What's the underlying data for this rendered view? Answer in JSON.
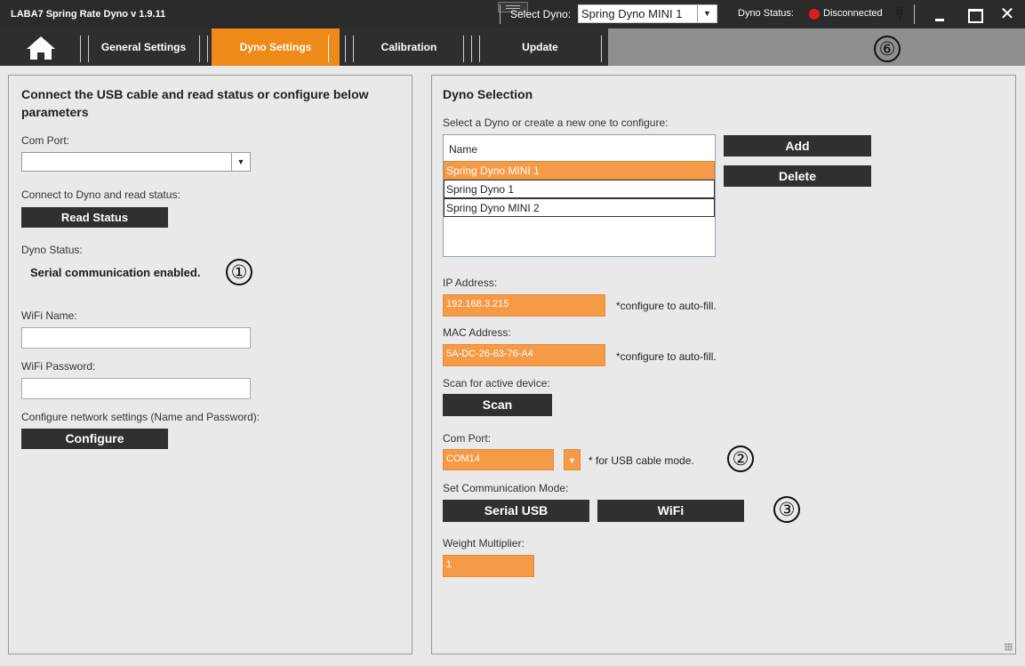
{
  "window": {
    "title": "LABA7 Spring Rate Dyno v 1.9.11",
    "select_dyno_label": "Select Dyno:",
    "selected_dyno": "Spring Dyno MINI 1",
    "status_label": "Dyno Status:",
    "status_value": "Disconnected",
    "status_color": "#e31b1b",
    "close_glyph": "✕"
  },
  "nav": {
    "home_icon": "home-icon",
    "tabs": [
      {
        "label": "General Settings",
        "active": false
      },
      {
        "label": "Dyno Settings",
        "active": true
      },
      {
        "label": "Calibration",
        "active": false
      },
      {
        "label": "Update",
        "active": false
      }
    ],
    "active_color": "#ee8a17"
  },
  "annotations": {
    "n1": "①",
    "n2": "②",
    "n3": "③",
    "n6": "⑥"
  },
  "left": {
    "heading": "Connect the USB cable and read status or configure below parameters",
    "com_port_label": "Com Port:",
    "com_port_value": "",
    "read_label": "Connect to Dyno and read status:",
    "read_button": "Read Status",
    "dyno_status_label": "Dyno Status:",
    "dyno_status_value": "Serial communication enabled.",
    "wifi_name_label": "WiFi Name:",
    "wifi_name_value": "",
    "wifi_password_label": "WiFi Password:",
    "wifi_password_value": "",
    "configure_label": "Configure network settings (Name and Password):",
    "configure_button": "Configure"
  },
  "right": {
    "heading": "Dyno Selection",
    "select_prompt": "Select a Dyno or create a new one to configure:",
    "table_header": "Name",
    "dynos": [
      "Spring Dyno MINI 1",
      "Spring Dyno 1",
      "Spring Dyno MINI 2"
    ],
    "selected_index": 0,
    "add_button": "Add",
    "delete_button": "Delete",
    "ip_label": "IP Address:",
    "ip_value": "192.168.3.215",
    "ip_note": "*configure to auto-fill.",
    "mac_label": "MAC Address:",
    "mac_value": "5A-DC-26-63-76-A4",
    "mac_note": "*configure to auto-fill.",
    "scan_label": "Scan for active device:",
    "scan_button": "Scan",
    "com_port_label": "Com Port:",
    "com_port_value": "COM14",
    "com_port_note": "* for USB cable mode.",
    "mode_label": "Set Communication Mode:",
    "serial_button": "Serial USB",
    "wifi_button": "WiFi",
    "weight_label": "Weight Multiplier:",
    "weight_value": "1",
    "field_color": "#f59a47"
  }
}
